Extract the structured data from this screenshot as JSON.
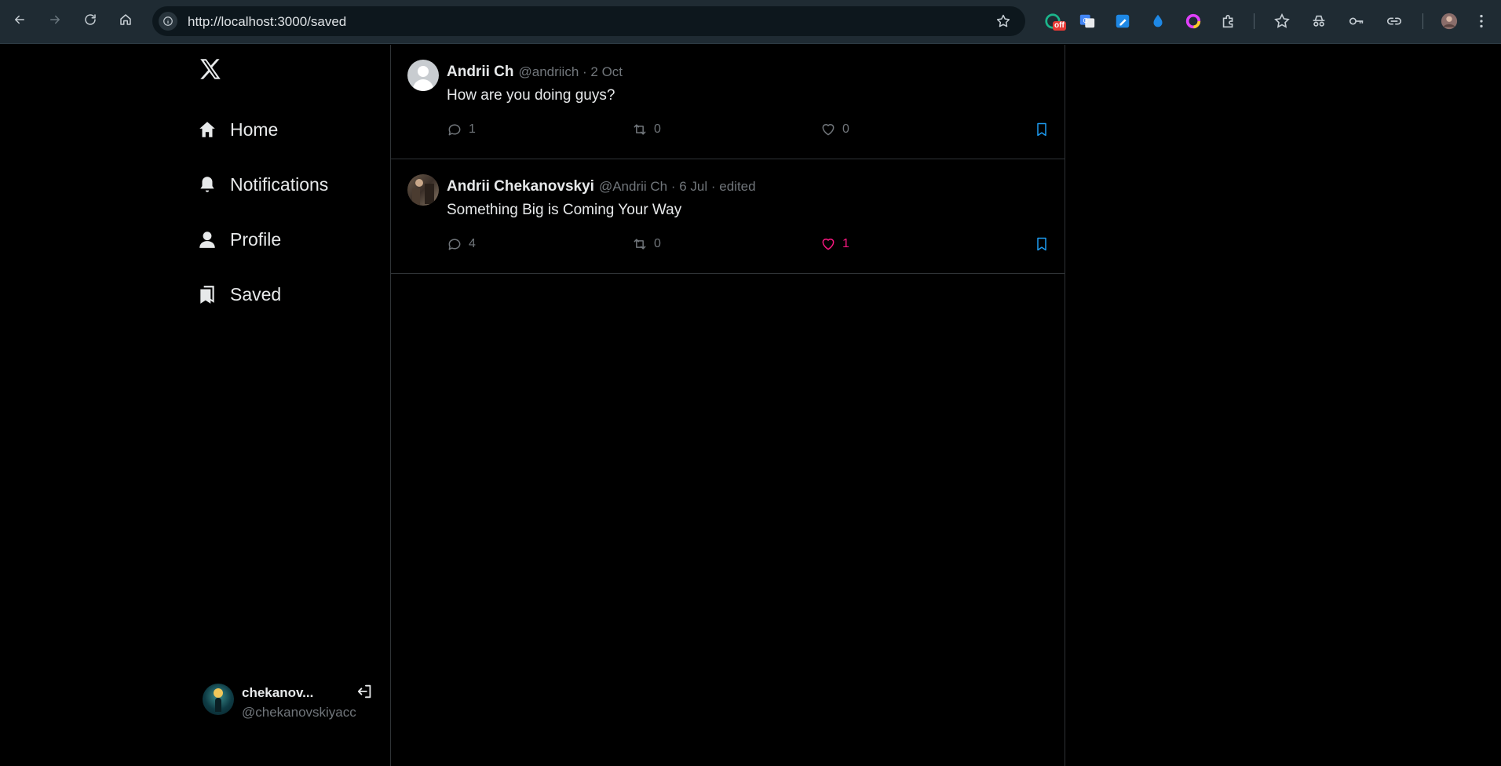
{
  "browser": {
    "url": "http://localhost:3000/saved",
    "extension_badge": "off"
  },
  "sidebar": {
    "logo_icon": "x-logo-icon",
    "items": [
      {
        "label": "Home",
        "icon": "home-icon"
      },
      {
        "label": "Notifications",
        "icon": "bell-icon"
      },
      {
        "label": "Profile",
        "icon": "person-icon"
      },
      {
        "label": "Saved",
        "icon": "bookmark-icon"
      }
    ],
    "account": {
      "name": "chekanov...",
      "handle": "@chekanovskiyacc"
    }
  },
  "posts": [
    {
      "name": "Andrii Ch",
      "meta": "@andriich · 2 Oct",
      "text": "How are you doing guys?",
      "replies": "1",
      "reposts": "0",
      "likes": "0",
      "liked": false,
      "saved": true
    },
    {
      "name": "Andrii Chekanovskyi",
      "meta": "@Andrii Ch · 6 Jul · edited",
      "text": "Something Big is Coming Your Way",
      "replies": "4",
      "reposts": "0",
      "likes": "1",
      "liked": true,
      "saved": true
    }
  ],
  "colors": {
    "accent": "#1d9bf0",
    "like": "#f91880",
    "background": "#000000",
    "border": "#2f3336"
  }
}
